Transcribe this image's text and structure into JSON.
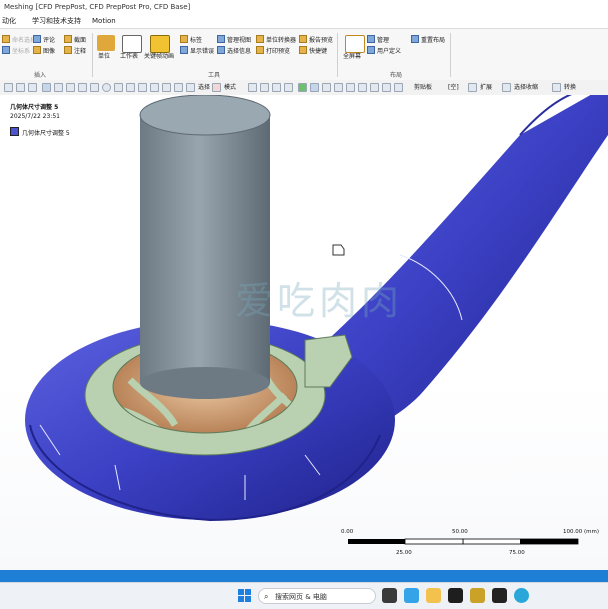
{
  "window_title": "Meshing [CFD PrepPost, CFD PrepPost Pro, CFD Base]",
  "menu": [
    "动化",
    "学习和技术支持",
    "Motion"
  ],
  "ribbon": {
    "group1": {
      "items": [
        "命名选择",
        "坐标系",
        "评论",
        "图像",
        "截面",
        "注释"
      ],
      "label": "插入"
    },
    "group2": {
      "big": [
        "单位",
        "工作表",
        "关键帧动画"
      ],
      "items": [
        "标签",
        "显示错误",
        "管理视图",
        "选择信息",
        "单位转换器",
        "打印预览",
        "报告预览",
        "快捷键"
      ],
      "label": "工具"
    },
    "group3": {
      "big": "全屏幕",
      "items": [
        "管理",
        "用户定义",
        "重置布局"
      ],
      "label": "布局"
    }
  },
  "toolbar": {
    "select": "选择",
    "mode": "模式",
    "clipboard": "剪贴板",
    "empty": "[空]",
    "expand": "扩展",
    "select_grow": "选择收缩",
    "convert": "转换"
  },
  "viewport": {
    "title": "几何体尺寸调整 5",
    "timestamp": "2025/7/22 23:51",
    "legend_label": "几何体尺寸调整 5",
    "watermark": "爱吃肉肉",
    "scale": {
      "top": [
        "0.00",
        "50.00",
        "100.00 (mm)"
      ],
      "bottom": [
        "25.00",
        "75.00"
      ]
    },
    "colors": {
      "pipe": "#3b40c4",
      "shaft": "#7f8d97",
      "impeller": "#b9d1b0",
      "hub": "#cfa27a"
    }
  },
  "taskbar": {
    "search_placeholder": "搜索网页 & 电脑"
  }
}
